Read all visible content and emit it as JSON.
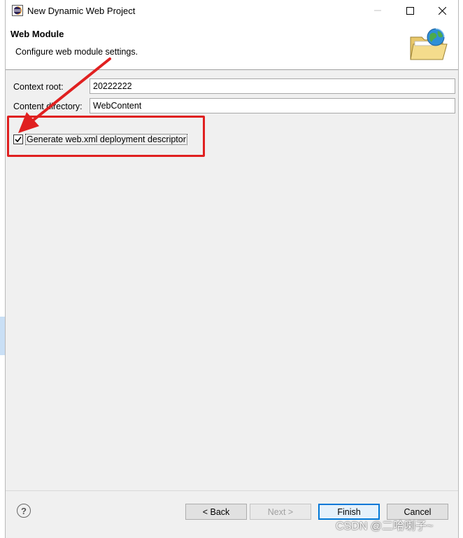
{
  "window": {
    "title": "New Dynamic Web Project",
    "minimize_icon": "minimize-icon",
    "maximize_icon": "maximize-icon",
    "close_icon": "close-icon"
  },
  "banner": {
    "title": "Web Module",
    "description": "Configure web module settings.",
    "icon": "globe-folder-icon"
  },
  "form": {
    "context_root": {
      "label": "Context root:",
      "value": "20222222"
    },
    "content_directory": {
      "label": "Content directory:",
      "value": "WebContent"
    },
    "generate_descriptor": {
      "label": "Generate web.xml deployment descriptor",
      "checked": true
    }
  },
  "buttons": {
    "help_glyph": "?",
    "back": "< Back",
    "next": "Next >",
    "finish": "Finish",
    "cancel": "Cancel"
  },
  "annotation": {
    "highlight_color": "#e02020"
  },
  "watermark": "CSDN @二哈喇子~",
  "colors": {
    "accent": "#0078d7",
    "annotation_red": "#e02020"
  }
}
